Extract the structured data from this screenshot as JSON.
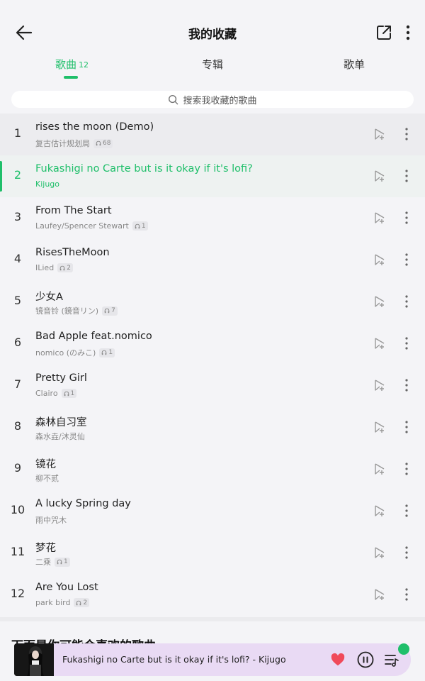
{
  "header": {
    "title": "我的收藏"
  },
  "tabs": [
    {
      "label": "歌曲",
      "count": "12",
      "active": true
    },
    {
      "label": "专辑"
    },
    {
      "label": "歌单"
    }
  ],
  "search": {
    "placeholder": "搜索我收藏的歌曲"
  },
  "songs": [
    {
      "index": "1",
      "title": "rises the moon (Demo)",
      "artist": "复古估计规划局",
      "badge": "68"
    },
    {
      "index": "2",
      "title": "Fukashigi no Carte but is it okay if it's lofi?",
      "artist": "Kijugo",
      "badge": ""
    },
    {
      "index": "3",
      "title": "From The Start",
      "artist": "Laufey/Spencer Stewart",
      "badge": "1"
    },
    {
      "index": "4",
      "title": "RisesTheMoon",
      "artist": "ILied",
      "badge": "2"
    },
    {
      "index": "5",
      "title": "少女A",
      "artist": "镜音铃 (鏡音リン)",
      "badge": "7"
    },
    {
      "index": "6",
      "title": "Bad Apple feat.nomico",
      "artist": "nomico (のみこ)",
      "badge": "1"
    },
    {
      "index": "7",
      "title": "Pretty Girl",
      "artist": "Clairo",
      "badge": "1"
    },
    {
      "index": "8",
      "title": "森林自习室",
      "artist": "森水垚/沐灵仙",
      "badge": ""
    },
    {
      "index": "9",
      "title": "镜花",
      "artist": "柳不贰",
      "badge": ""
    },
    {
      "index": "10",
      "title": "A lucky Spring day",
      "artist": "雨中咒木",
      "badge": ""
    },
    {
      "index": "11",
      "title": "梦花",
      "artist": "二乘",
      "badge": "1"
    },
    {
      "index": "12",
      "title": "Are You Lost",
      "artist": "park bird",
      "badge": "2"
    }
  ],
  "recommend": {
    "title": "下面是你可能会喜欢的歌曲"
  },
  "player": {
    "now_playing": "Fukashigi no Carte but is it okay if it's lofi? - Kijugo"
  },
  "colors": {
    "accent": "#1fbf6a",
    "player_bg": "#e9daf4",
    "heart": "#f04a5a"
  },
  "icons": [
    "back-arrow-icon",
    "share-icon",
    "more-vertical-icon",
    "search-icon",
    "headphones-icon",
    "add-to-playlist-icon",
    "heart-icon",
    "pause-icon",
    "queue-icon"
  ]
}
